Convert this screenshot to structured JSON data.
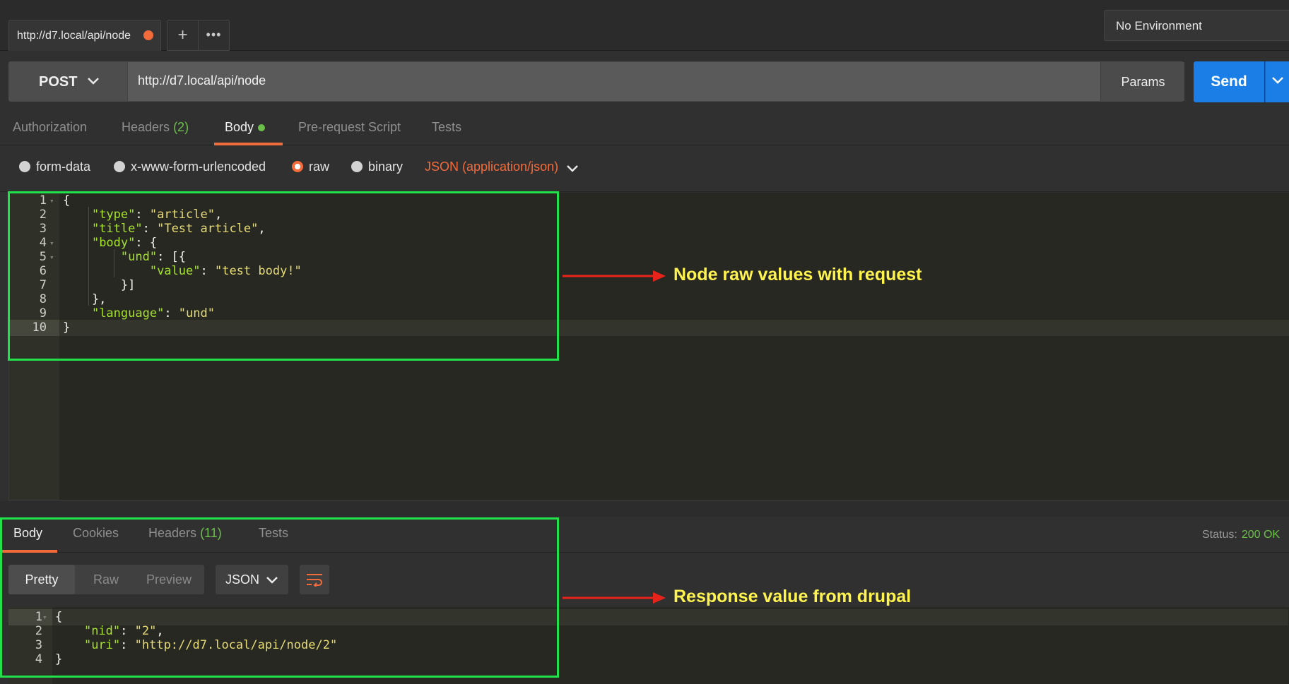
{
  "tab": {
    "label": "http://d7.local/api/node"
  },
  "environment": {
    "selected": "No Environment"
  },
  "request": {
    "method": "POST",
    "url": "http://d7.local/api/node",
    "params_label": "Params",
    "send_label": "Send"
  },
  "request_tabs": {
    "authorization": "Authorization",
    "headers": "Headers",
    "headers_count": "(2)",
    "body": "Body",
    "prerequest": "Pre-request Script",
    "tests": "Tests"
  },
  "body_types": {
    "form_data": "form-data",
    "urlencoded": "x-www-form-urlencoded",
    "raw": "raw",
    "binary": "binary",
    "content_type": "JSON (application/json)"
  },
  "request_body_lines": [
    {
      "n": "1",
      "t": [
        [
          "p",
          "{"
        ]
      ]
    },
    {
      "n": "2",
      "t": [
        [
          "p",
          "    "
        ],
        [
          "k",
          "\"type\""
        ],
        [
          "p",
          ": "
        ],
        [
          "s",
          "\"article\""
        ],
        [
          "p",
          ","
        ]
      ]
    },
    {
      "n": "3",
      "t": [
        [
          "p",
          "    "
        ],
        [
          "k",
          "\"title\""
        ],
        [
          "p",
          ": "
        ],
        [
          "s",
          "\"Test article\""
        ],
        [
          "p",
          ","
        ]
      ]
    },
    {
      "n": "4",
      "t": [
        [
          "p",
          "    "
        ],
        [
          "k",
          "\"body\""
        ],
        [
          "p",
          ": {"
        ]
      ]
    },
    {
      "n": "5",
      "t": [
        [
          "p",
          "        "
        ],
        [
          "k",
          "\"und\""
        ],
        [
          "p",
          ": [{"
        ]
      ]
    },
    {
      "n": "6",
      "t": [
        [
          "p",
          "            "
        ],
        [
          "k",
          "\"value\""
        ],
        [
          "p",
          ": "
        ],
        [
          "s",
          "\"test body!\""
        ]
      ]
    },
    {
      "n": "7",
      "t": [
        [
          "p",
          "        }]"
        ]
      ]
    },
    {
      "n": "8",
      "t": [
        [
          "p",
          "    },"
        ]
      ]
    },
    {
      "n": "9",
      "t": [
        [
          "p",
          "    "
        ],
        [
          "k",
          "\"language\""
        ],
        [
          "p",
          ": "
        ],
        [
          "s",
          "\"und\""
        ]
      ]
    },
    {
      "n": "10",
      "t": [
        [
          "p",
          "}"
        ]
      ]
    }
  ],
  "response_tabs": {
    "body": "Body",
    "cookies": "Cookies",
    "headers": "Headers",
    "headers_count": "(11)",
    "tests": "Tests"
  },
  "status": {
    "label": "Status:",
    "value": "200 OK"
  },
  "response_view": {
    "pretty": "Pretty",
    "raw": "Raw",
    "preview": "Preview",
    "format": "JSON"
  },
  "response_body_lines": [
    {
      "n": "1",
      "t": [
        [
          "p",
          "{"
        ]
      ]
    },
    {
      "n": "2",
      "t": [
        [
          "p",
          "    "
        ],
        [
          "k",
          "\"nid\""
        ],
        [
          "p",
          ": "
        ],
        [
          "s",
          "\"2\""
        ],
        [
          "p",
          ","
        ]
      ]
    },
    {
      "n": "3",
      "t": [
        [
          "p",
          "    "
        ],
        [
          "k",
          "\"uri\""
        ],
        [
          "p",
          ": "
        ],
        [
          "s",
          "\"http://d7.local/api/node/2\""
        ]
      ]
    },
    {
      "n": "4",
      "t": [
        [
          "p",
          "}"
        ]
      ]
    }
  ],
  "annotations": {
    "request": "Node raw values with request",
    "response": "Response value from drupal"
  },
  "colors": {
    "accent": "#f26b3a",
    "send": "#1a7ee6",
    "count_green": "#6cc04a",
    "highlight_box": "#22e14a",
    "annotation_text": "#fff44f",
    "arrow": "#e8231c"
  }
}
